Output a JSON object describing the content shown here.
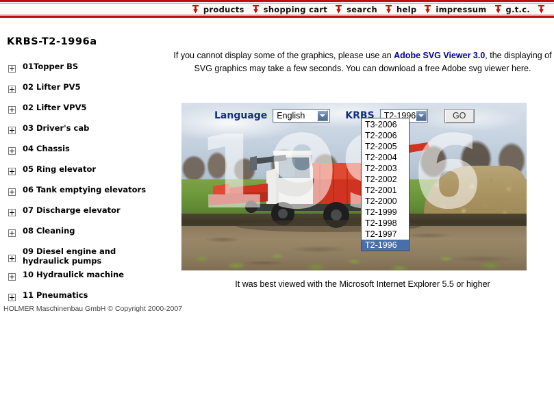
{
  "nav": {
    "items": [
      {
        "label": "products",
        "icon": "pin-down-icon"
      },
      {
        "label": "shopping cart",
        "icon": "pin-down-icon"
      },
      {
        "label": "search",
        "icon": "pin-down-icon"
      },
      {
        "label": "help",
        "icon": "pin-down-icon"
      },
      {
        "label": "impressum",
        "icon": "pin-down-icon"
      },
      {
        "label": "g.t.c.",
        "icon": "pin-down-icon"
      }
    ],
    "accent_color": "#c00d0d"
  },
  "sidebar": {
    "title": "KRBS-T2-1996a",
    "items": [
      {
        "label": "01Topper BS",
        "expander": "+"
      },
      {
        "label": "02 Lifter PV5",
        "expander": "+"
      },
      {
        "label": "02 Lifter VPV5",
        "expander": "+"
      },
      {
        "label": "03 Driver's cab",
        "expander": "+"
      },
      {
        "label": "04 Chassis",
        "expander": "+"
      },
      {
        "label": "05 Ring elevator",
        "expander": "+"
      },
      {
        "label": "06 Tank emptying elevators",
        "expander": "+"
      },
      {
        "label": "07 Discharge elevator",
        "expander": "+"
      },
      {
        "label": "08 Cleaning",
        "expander": "+"
      },
      {
        "label": "09 Diesel engine and hydraulick pumps",
        "expander": "+"
      },
      {
        "label": "10 Hydraulick machine",
        "expander": "+"
      },
      {
        "label": "11 Pneumatics",
        "expander": "+"
      }
    ],
    "copyright": "HOLMER Maschinenbau GmbH © Copyright 2000-2007"
  },
  "main": {
    "notice_part1": "If you cannot display some of the graphics, please use an ",
    "notice_link": "Adobe SVG Viewer 3.0",
    "notice_part2": ", the displaying of SVG graphics may take a few seconds. You can download a free Adobe svg viewer here.",
    "link_color": "#00009c",
    "banner": {
      "watermark": "1996",
      "alt": "sugar beet harvester working in a field with beet pile"
    },
    "form": {
      "language_label": "Language",
      "language_value": "English",
      "language_options": [
        "English"
      ],
      "krbs_label": "KRBS",
      "krbs_value": "T2-1996",
      "krbs_options": [
        "T3-2006",
        "T2-2006",
        "T2-2005",
        "T2-2004",
        "T2-2003",
        "T2-2002",
        "T2-2001",
        "T2-2000",
        "T2-1999",
        "T2-1998",
        "T2-1997",
        "T2-1996"
      ],
      "krbs_selected_index": 11,
      "go_label": "GO",
      "dropdown_open": true,
      "highlight_color": "#4a6ea9"
    },
    "ie_notice": "It was best viewed with the Microsoft Internet Explorer 5.5 or higher"
  }
}
